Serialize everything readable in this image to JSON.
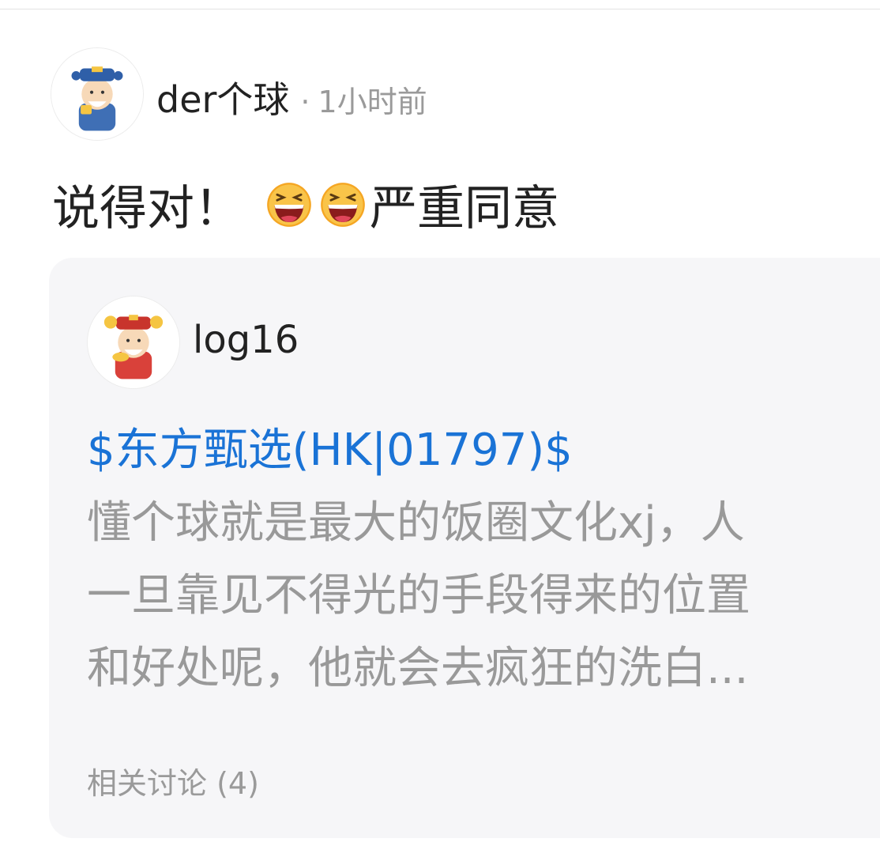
{
  "post": {
    "author": "der个球",
    "separator": "·",
    "time": "1小时前",
    "text_before": "说得对！",
    "emoji": [
      "laughing-face",
      "laughing-face"
    ],
    "text_after": "严重同意"
  },
  "quote": {
    "author": "log16",
    "stock_tag": "$东方甄选(HK|01797)$",
    "body_lines": [
      "懂个球就是最大的饭圈文化xj，人",
      "一旦靠见不得光的手段得来的位置",
      "和好处呢，他就会去疯狂的洗白..."
    ],
    "related": "相关讨论 (4)"
  },
  "colors": {
    "link": "#1a73d6",
    "muted": "#9a9a9a",
    "card_bg": "#f6f6f8"
  }
}
